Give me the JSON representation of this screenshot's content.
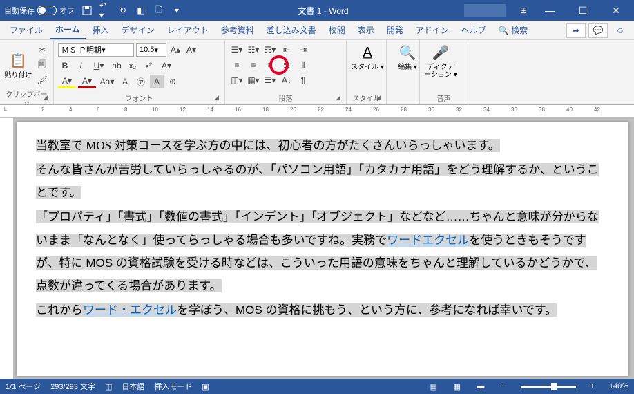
{
  "titlebar": {
    "autosave_label": "自動保存",
    "autosave_state": "オフ",
    "doc_title": "文書 1  -  Word"
  },
  "tabs": {
    "file": "ファイル",
    "home": "ホーム",
    "insert": "挿入",
    "design": "デザイン",
    "layout": "レイアウト",
    "references": "参考資料",
    "mailings": "差し込み文書",
    "review": "校閲",
    "view": "表示",
    "developer": "開発",
    "addins": "アドイン",
    "help": "ヘルプ",
    "search": "検索"
  },
  "ribbon": {
    "clipboard_label": "クリップボード",
    "paste": "貼り付け",
    "font_label": "フォント",
    "font_name": "ＭＳ Ｐ明朝",
    "font_size": "10.5",
    "paragraph_label": "段落",
    "styles_label": "スタイル",
    "styles_btn": "スタイル",
    "editing_label": "編集",
    "editing_btn": "編集",
    "voice_label": "音声",
    "dictation_btn": "ディクテーション"
  },
  "document": {
    "p1": "当教室で MOS 対策コースを学ぶ方の中には、初心者の方がたくさんいらっしゃいます。",
    "p2": "そんな皆さんが苦労していらっしゃるのが、「パソコン用語」「カタカナ用語」をどう理解するか、ということです。",
    "p3a": "「プロパティ」「書式」「数値の書式」「インデント」「オブジェクト」などなど……ちゃんと意味が分からないまま「なんとなく」使ってらっしゃる場合も多いですね。実務で",
    "p3_link1": "ワード",
    "p3_link2": "エクセル",
    "p3b": "を使うときもそうですが、特に MOS の資格試験を受ける時などは、こういった用語の意味をちゃんと理解しているかどうかで、点数が違ってくる場合があります。",
    "p4a": "これから",
    "p4_link": "ワード・エクセル",
    "p4b": "を学ぼう、MOS の資格に挑もう、という方に、参考になれば幸いです。"
  },
  "status": {
    "page": "1/1 ページ",
    "words": "293/293 文字",
    "lang": "日本語",
    "mode": "挿入モード",
    "zoom": "140%"
  },
  "ruler_ticks": [
    2,
    4,
    6,
    8,
    10,
    12,
    14,
    16,
    18,
    20,
    22,
    24,
    26,
    28,
    30,
    32,
    34,
    36,
    38,
    40,
    42
  ]
}
